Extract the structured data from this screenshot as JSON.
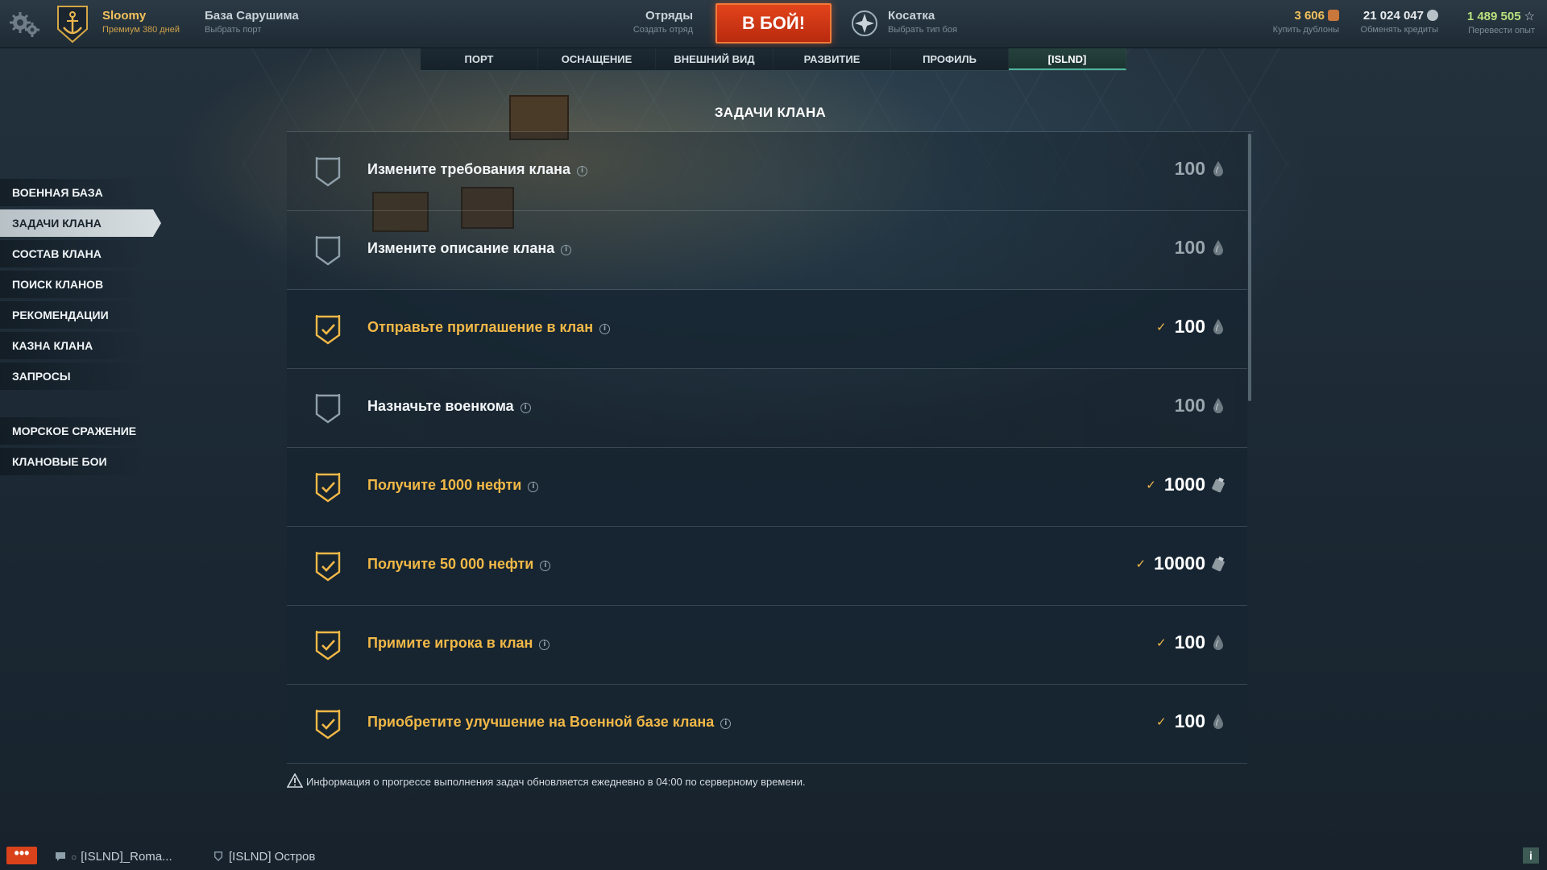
{
  "header": {
    "username": "Sloomy",
    "premium": "Премиум 380 дней",
    "port_title": "База Сарушима",
    "port_sub": "Выбрать порт",
    "squads_title": "Отряды",
    "squads_sub": "Создать отряд",
    "battle_label": "В БОЙ!",
    "battle_type_title": "Косатка",
    "battle_type_sub": "Выбрать тип боя",
    "doubloons": {
      "value": "3 606",
      "label": "Купить дублоны",
      "color": "#f3c15c"
    },
    "credits": {
      "value": "21 024 047",
      "label": "Обменять кредиты",
      "color": "#e8ecef"
    },
    "xp": {
      "value": "1 489 505",
      "label": "Перевести опыт",
      "color": "#b8e07c"
    }
  },
  "tabs": [
    {
      "label": "ПОРТ"
    },
    {
      "label": "ОСНАЩЕНИЕ"
    },
    {
      "label": "ВНЕШНИЙ ВИД"
    },
    {
      "label": "РАЗВИТИЕ"
    },
    {
      "label": "ПРОФИЛЬ"
    },
    {
      "label": "[ISLND]",
      "active": true
    }
  ],
  "sidebar": {
    "items": [
      {
        "label": "ВОЕННАЯ БАЗА"
      },
      {
        "label": "ЗАДАЧИ КЛАНА",
        "active": true
      },
      {
        "label": "СОСТАВ КЛАНА"
      },
      {
        "label": "ПОИСК КЛАНОВ"
      },
      {
        "label": "РЕКОМЕНДАЦИИ"
      },
      {
        "label": "КАЗНА КЛАНА"
      },
      {
        "label": "ЗАПРОСЫ"
      }
    ],
    "items2": [
      {
        "label": "МОРСКОЕ СРАЖЕНИЕ"
      },
      {
        "label": "КЛАНОВЫЕ БОИ"
      }
    ]
  },
  "main": {
    "title": "ЗАДАЧИ КЛАНА",
    "tasks": [
      {
        "title": "Измените требования клана",
        "reward": "100",
        "done": false,
        "icon": "oil-drop-icon"
      },
      {
        "title": "Измените описание клана",
        "reward": "100",
        "done": false,
        "icon": "oil-drop-icon"
      },
      {
        "title": "Отправьте приглашение в клан",
        "reward": "100",
        "done": true,
        "icon": "oil-drop-icon"
      },
      {
        "title": "Назначьте военкома",
        "reward": "100",
        "done": false,
        "icon": "oil-drop-icon"
      },
      {
        "title": "Получите 1000 нефти",
        "reward": "1000",
        "done": true,
        "icon": "oil-barrel-icon"
      },
      {
        "title": "Получите 50 000 нефти",
        "reward": "10000",
        "done": true,
        "icon": "oil-barrel-icon"
      },
      {
        "title": "Примите игрока в клан",
        "reward": "100",
        "done": true,
        "icon": "oil-drop-icon"
      },
      {
        "title": "Приобретите улучшение на Военной базе клана",
        "reward": "100",
        "done": true,
        "icon": "oil-drop-icon"
      }
    ],
    "note": "Информация о прогрессе выполнения задач обновляется ежедневно в 04:00 по серверному времени."
  },
  "bottom": {
    "chat_label": "•••",
    "chat1": "[ISLND]_Roma...",
    "chat2": "[ISLND] Остров",
    "info_label": "i"
  },
  "colors": {
    "accent_gold": "#f2b847",
    "battle_red": "#d9421b",
    "tab_active": "#4fb59e"
  }
}
